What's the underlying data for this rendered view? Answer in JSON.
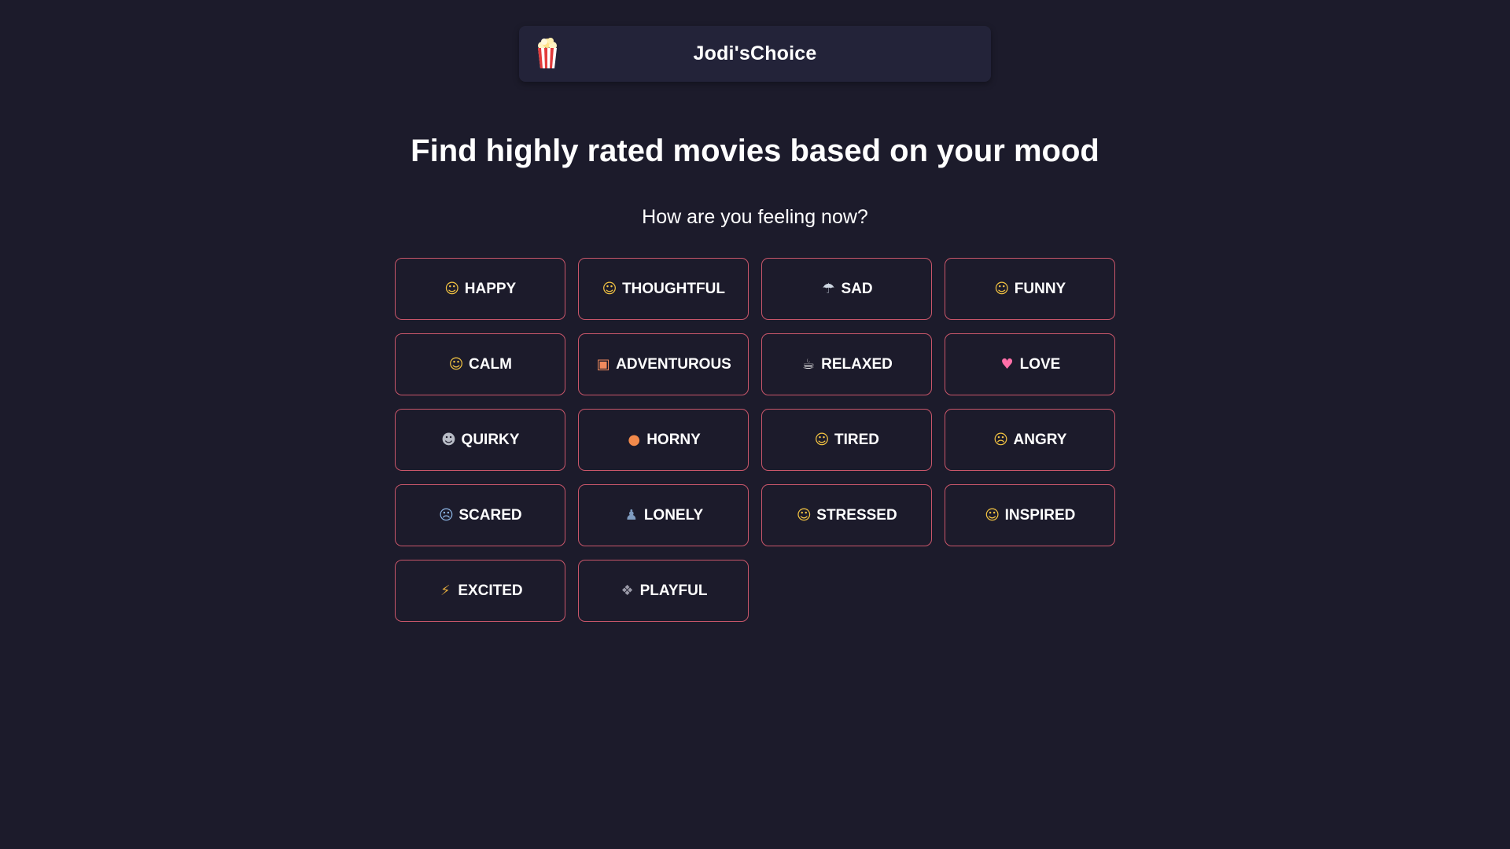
{
  "header": {
    "brand": "Jodi'sChoice",
    "logo_icon": "popcorn-icon"
  },
  "main": {
    "headline": "Find highly rated movies based on your mood",
    "prompt": "How are you feeling now?"
  },
  "accent_color": "#c9566a",
  "background_color": "#1c1b2b",
  "moods": [
    {
      "label": "HAPPY",
      "icon": "grinning-face-icon",
      "glyph": "☺",
      "color": "#f5c542"
    },
    {
      "label": "THOUGHTFUL",
      "icon": "thinking-face-icon",
      "glyph": "☺",
      "color": "#f5c542"
    },
    {
      "label": "SAD",
      "icon": "rain-cloud-icon",
      "glyph": "☂",
      "color": "#cfd8e3"
    },
    {
      "label": "FUNNY",
      "icon": "tears-of-joy-face-icon",
      "glyph": "☺",
      "color": "#f5c542"
    },
    {
      "label": "CALM",
      "icon": "pensive-face-icon",
      "glyph": "☺",
      "color": "#f5c542"
    },
    {
      "label": "ADVENTUROUS",
      "icon": "sunrise-picture-icon",
      "glyph": "▣",
      "color": "#f08a5d"
    },
    {
      "label": "RELAXED",
      "icon": "hot-beverage-icon",
      "glyph": "☕",
      "color": "#e8e8e8"
    },
    {
      "label": "LOVE",
      "icon": "sparkling-heart-icon",
      "glyph": "♥",
      "color": "#ff6fa8"
    },
    {
      "label": "QUIRKY",
      "icon": "alien-icon",
      "glyph": "☻",
      "color": "#b8bcc6"
    },
    {
      "label": "HORNY",
      "icon": "peach-icon",
      "glyph": "●",
      "color": "#f28a4b"
    },
    {
      "label": "TIRED",
      "icon": "sleeping-face-icon",
      "glyph": "☺",
      "color": "#f5c542"
    },
    {
      "label": "ANGRY",
      "icon": "angry-face-icon",
      "glyph": "☹",
      "color": "#f5c542"
    },
    {
      "label": "SCARED",
      "icon": "fearful-face-icon",
      "glyph": "☹",
      "color": "#8fb8e8"
    },
    {
      "label": "LONELY",
      "icon": "bust-silhouette-icon",
      "glyph": "♟",
      "color": "#7f9cc0"
    },
    {
      "label": "STRESSED",
      "icon": "grimacing-face-icon",
      "glyph": "☺",
      "color": "#f5c542"
    },
    {
      "label": "INSPIRED",
      "icon": "nerd-face-icon",
      "glyph": "☺",
      "color": "#f5c542"
    },
    {
      "label": "EXCITED",
      "icon": "roller-coaster-icon",
      "glyph": "⚡",
      "color": "#d9a53c"
    },
    {
      "label": "PLAYFUL",
      "icon": "paw-prints-icon",
      "glyph": "❖",
      "color": "#9a9aa8"
    }
  ]
}
